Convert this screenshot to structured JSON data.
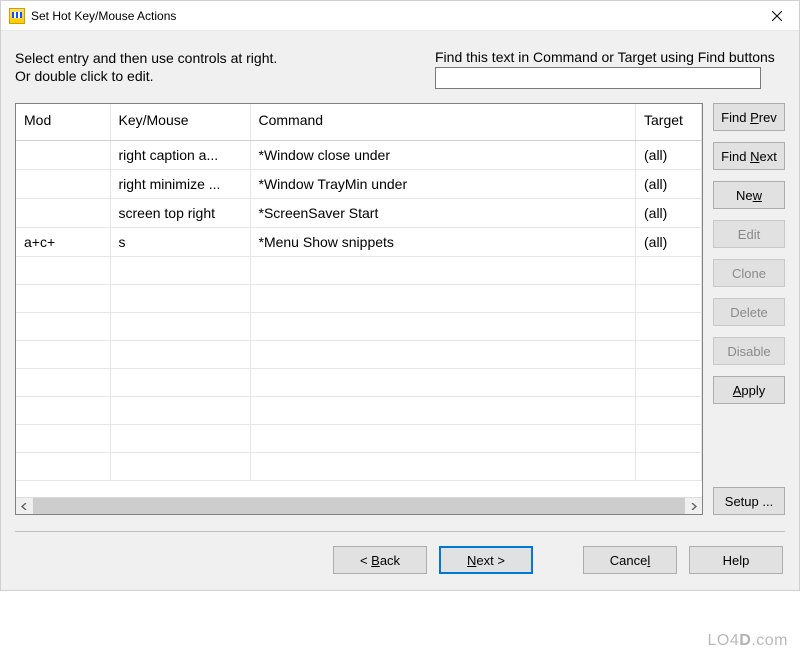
{
  "window": {
    "title": "Set Hot Key/Mouse Actions"
  },
  "instructions": {
    "line1": "Select entry and then use controls at right.",
    "line2": "Or double click to edit."
  },
  "find": {
    "label": "Find this text in Command or Target using Find buttons",
    "value": ""
  },
  "grid": {
    "columns": {
      "mod": "Mod",
      "key": "Key/Mouse",
      "command": "Command",
      "target": "Target"
    },
    "rows": [
      {
        "mod": "",
        "key": "right caption a...",
        "command": "*Window close under",
        "target": "(all)"
      },
      {
        "mod": "",
        "key": "right minimize ...",
        "command": "*Window TrayMin under",
        "target": "(all)"
      },
      {
        "mod": "",
        "key": "screen top right",
        "command": "*ScreenSaver Start",
        "target": "(all)"
      },
      {
        "mod": "a+c+",
        "key": "s",
        "command": "*Menu Show snippets",
        "target": "(all)"
      }
    ]
  },
  "buttons": {
    "find_prev": "Find Prev",
    "find_next": "Find Next",
    "new": "New",
    "edit": "Edit",
    "clone": "Clone",
    "delete": "Delete",
    "disable": "Disable",
    "apply": "Apply",
    "setup": "Setup ..."
  },
  "nav": {
    "back": "< Back",
    "next": "Next >",
    "cancel": "Cancel",
    "help": "Help"
  },
  "watermark": "LO4D.com"
}
